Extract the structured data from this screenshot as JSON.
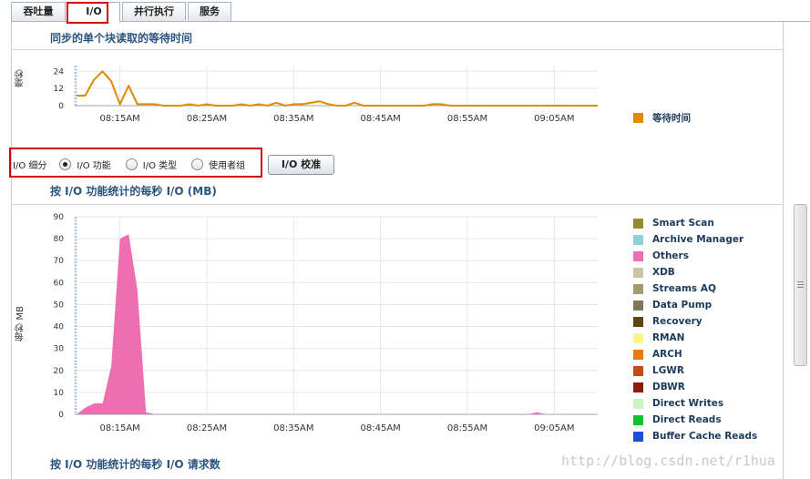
{
  "tabs": [
    {
      "label": "吞吐量",
      "active": false
    },
    {
      "label": "I/O",
      "active": true
    },
    {
      "label": "并行执行",
      "active": false
    },
    {
      "label": "服务",
      "active": false
    }
  ],
  "wait_section": {
    "title": "同步的单个块读取的等待时间",
    "ylabel": "毫秒",
    "legend": [
      {
        "name": "等待时间",
        "color": "#e08a00"
      }
    ]
  },
  "io_options": {
    "label": "I/O 细分",
    "radios": [
      {
        "label": "I/O 功能",
        "selected": true
      },
      {
        "label": "I/O 类型",
        "selected": false
      },
      {
        "label": "使用者组",
        "selected": false
      }
    ],
    "calibrate_button": "I/O 校准"
  },
  "mbps_section": {
    "title": "按 I/O 功能统计的每秒 I/O (MB)",
    "ylabel": "每秒 MB",
    "legend": [
      {
        "name": "Smart Scan",
        "color": "#8f8f2e"
      },
      {
        "name": "Archive Manager",
        "color": "#8fcfd6"
      },
      {
        "name": "Others",
        "color": "#ee6fb1"
      },
      {
        "name": "XDB",
        "color": "#cfc2a4"
      },
      {
        "name": "Streams AQ",
        "color": "#a59a72"
      },
      {
        "name": "Data Pump",
        "color": "#7f7858"
      },
      {
        "name": "Recovery",
        "color": "#5f4514"
      },
      {
        "name": "RMAN",
        "color": "#f8f58a"
      },
      {
        "name": "ARCH",
        "color": "#e87a12"
      },
      {
        "name": "LGWR",
        "color": "#c94818"
      },
      {
        "name": "DBWR",
        "color": "#8a1c10"
      },
      {
        "name": "Direct Writes",
        "color": "#c8f5c0"
      },
      {
        "name": "Direct Reads",
        "color": "#16c028"
      },
      {
        "name": "Buffer Cache Reads",
        "color": "#1b50d4"
      }
    ]
  },
  "requests_section": {
    "title": "按 I/O 功能统计的每秒 I/O 请求数"
  },
  "watermark": "http://blog.csdn.net/r1hua",
  "chart_data": [
    {
      "type": "line",
      "title": "同步的单个块读取的等待时间",
      "ylabel": "毫秒",
      "ylim": [
        0,
        28
      ],
      "yticks": [
        0,
        12,
        24
      ],
      "xticks": [
        "08:15AM",
        "08:25AM",
        "08:35AM",
        "08:45AM",
        "08:55AM",
        "09:05AM"
      ],
      "series": [
        {
          "name": "等待时间",
          "color": "#e08a00",
          "x": [
            0,
            1,
            2,
            3,
            4,
            5,
            6,
            7,
            8,
            9,
            10,
            11,
            12,
            13,
            14,
            15,
            16,
            17,
            18,
            19,
            20,
            21,
            22,
            23,
            24,
            25,
            26,
            27,
            28,
            29,
            30,
            31,
            32,
            33,
            34,
            35,
            36,
            37,
            38,
            39,
            40,
            41,
            42,
            43,
            44,
            45,
            46,
            47,
            48,
            49,
            50,
            51,
            52,
            53,
            54,
            55,
            56,
            57,
            58,
            59,
            60
          ],
          "values": [
            7,
            7,
            18,
            24,
            17,
            1,
            14,
            1,
            1,
            1,
            0,
            0,
            0,
            1,
            0,
            1,
            0,
            0,
            0,
            1,
            0,
            1,
            0,
            2,
            0,
            1,
            1,
            2,
            3,
            1,
            0,
            0,
            2,
            0,
            0,
            0,
            0,
            0,
            0,
            0,
            0,
            1,
            1,
            0,
            0,
            0,
            0,
            0,
            0,
            0,
            0,
            0,
            0,
            0,
            0,
            0,
            0,
            0,
            0,
            0,
            0
          ]
        }
      ]
    },
    {
      "type": "area",
      "title": "按 I/O 功能统计的每秒 I/O (MB)",
      "ylabel": "每秒 MB",
      "ylim": [
        0,
        90
      ],
      "yticks": [
        0,
        10,
        20,
        30,
        40,
        50,
        60,
        70,
        80,
        90
      ],
      "xticks": [
        "08:15AM",
        "08:25AM",
        "08:35AM",
        "08:45AM",
        "08:55AM",
        "09:05AM"
      ],
      "series": [
        {
          "name": "Others",
          "color": "#ee6fb1",
          "x": [
            0,
            1,
            2,
            3,
            4,
            5,
            6,
            7,
            8,
            9,
            10,
            11,
            12,
            13,
            14,
            15,
            16,
            17,
            18,
            19,
            20,
            21,
            22,
            23,
            24,
            25,
            26,
            27,
            28,
            29,
            30,
            31,
            32,
            33,
            34,
            35,
            36,
            37,
            38,
            39,
            40,
            41,
            42,
            43,
            44,
            45,
            46,
            47,
            48,
            49,
            50,
            51,
            52,
            53,
            54,
            55,
            56,
            57,
            58,
            59,
            60
          ],
          "values": [
            0,
            3,
            5,
            5,
            22,
            80,
            82,
            57,
            1,
            0,
            0,
            0,
            0,
            0,
            0,
            0,
            0,
            0,
            0,
            0,
            0,
            0,
            0,
            0,
            0,
            0,
            0,
            0,
            0,
            0,
            0,
            0,
            0,
            0,
            0,
            0,
            0,
            0,
            0,
            0,
            0,
            0,
            0,
            0,
            0,
            0,
            0,
            0,
            0,
            0,
            0,
            0,
            0,
            1,
            0,
            0,
            0,
            0,
            0,
            0,
            0
          ]
        }
      ]
    }
  ]
}
